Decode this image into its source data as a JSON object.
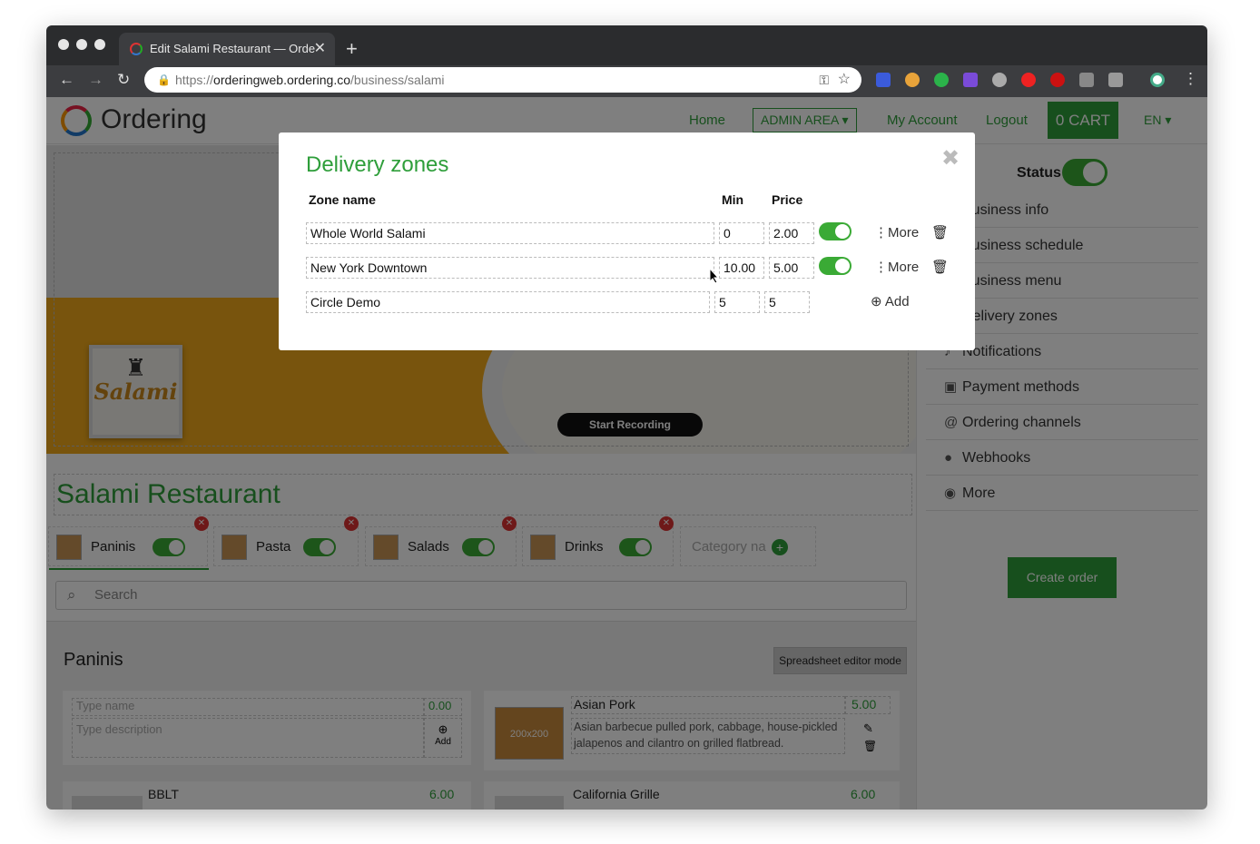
{
  "browser": {
    "tab_title": "Edit Salami Restaurant — Orde",
    "url_prefix": "https://",
    "url_host": "orderingweb.ordering.co",
    "url_path": "/business/salami"
  },
  "header": {
    "logo": "Ordering",
    "nav": [
      "Home",
      "ADMIN AREA",
      "My Account",
      "Logout"
    ],
    "cart": "0 CART",
    "lang": "EN"
  },
  "hero": {
    "logo_text": "Salami",
    "record_label": "Start Recording"
  },
  "sidebar": {
    "status_label": "Status",
    "items": [
      "Business info",
      "Business schedule",
      "Business menu",
      "Delivery zones",
      "Notifications",
      "Payment methods",
      "Ordering channels",
      "Webhooks",
      "More"
    ],
    "create_order": "Create order"
  },
  "main": {
    "restaurant_name": "Salami Restaurant",
    "categories": [
      "Paninis",
      "Pasta",
      "Salads",
      "Drinks"
    ],
    "new_category_placeholder": "Category na",
    "search_placeholder": "Search",
    "section_title": "Paninis",
    "spreadsheet_btn": "Spreadsheet editor mode",
    "new_product": {
      "name_placeholder": "Type name",
      "price_placeholder": "0.00",
      "desc_placeholder": "Type description",
      "add_label": "Add"
    },
    "products": [
      {
        "name": "Asian Pork",
        "price": "5.00",
        "description": "Asian barbecue pulled pork, cabbage, house-pickled jalapenos and cilantro on grilled flatbread.",
        "image_label": "200x200"
      },
      {
        "name": "BBLT",
        "price": "6.00"
      },
      {
        "name": "California Grille",
        "price": "6.00"
      }
    ]
  },
  "modal": {
    "title": "Delivery zones",
    "headers": {
      "zone": "Zone name",
      "min": "Min",
      "price": "Price"
    },
    "zones": [
      {
        "name": "Whole World Salami",
        "min": "0",
        "price": "2.00",
        "more": "More"
      },
      {
        "name": "New York Downtown",
        "min": "10.00",
        "price": "5.00",
        "more": "More"
      }
    ],
    "new_zone": {
      "name": "Circle Demo",
      "min": "5",
      "price": "5",
      "add": "Add"
    }
  },
  "colors": {
    "brand_green": "#2e9e3a",
    "toggle_green": "#3aaa35",
    "hero_orange": "#f0a81a"
  }
}
